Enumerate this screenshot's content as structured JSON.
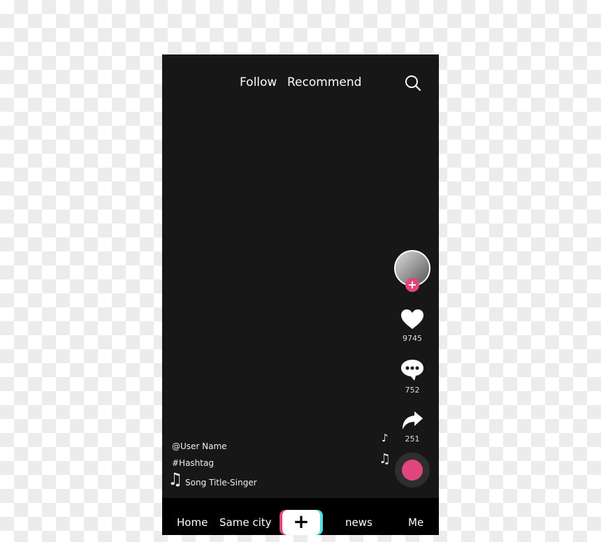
{
  "header": {
    "tabs": [
      {
        "label": "Follow"
      },
      {
        "label": "Recommend"
      }
    ],
    "search_icon": "search-icon"
  },
  "sidebar": {
    "likes": "9745",
    "comments": "752",
    "shares": "251"
  },
  "video": {
    "username": "@User Name",
    "hashtag": "#Hashtag",
    "song": "Song Title-Singer"
  },
  "nav": {
    "items": [
      {
        "label": "Home"
      },
      {
        "label": "Same city"
      },
      {
        "label": "+"
      },
      {
        "label": "news"
      },
      {
        "label": "Me"
      }
    ]
  },
  "colors": {
    "accent": "#e0457b",
    "cyan": "#4fe0e0",
    "background": "#171717"
  }
}
